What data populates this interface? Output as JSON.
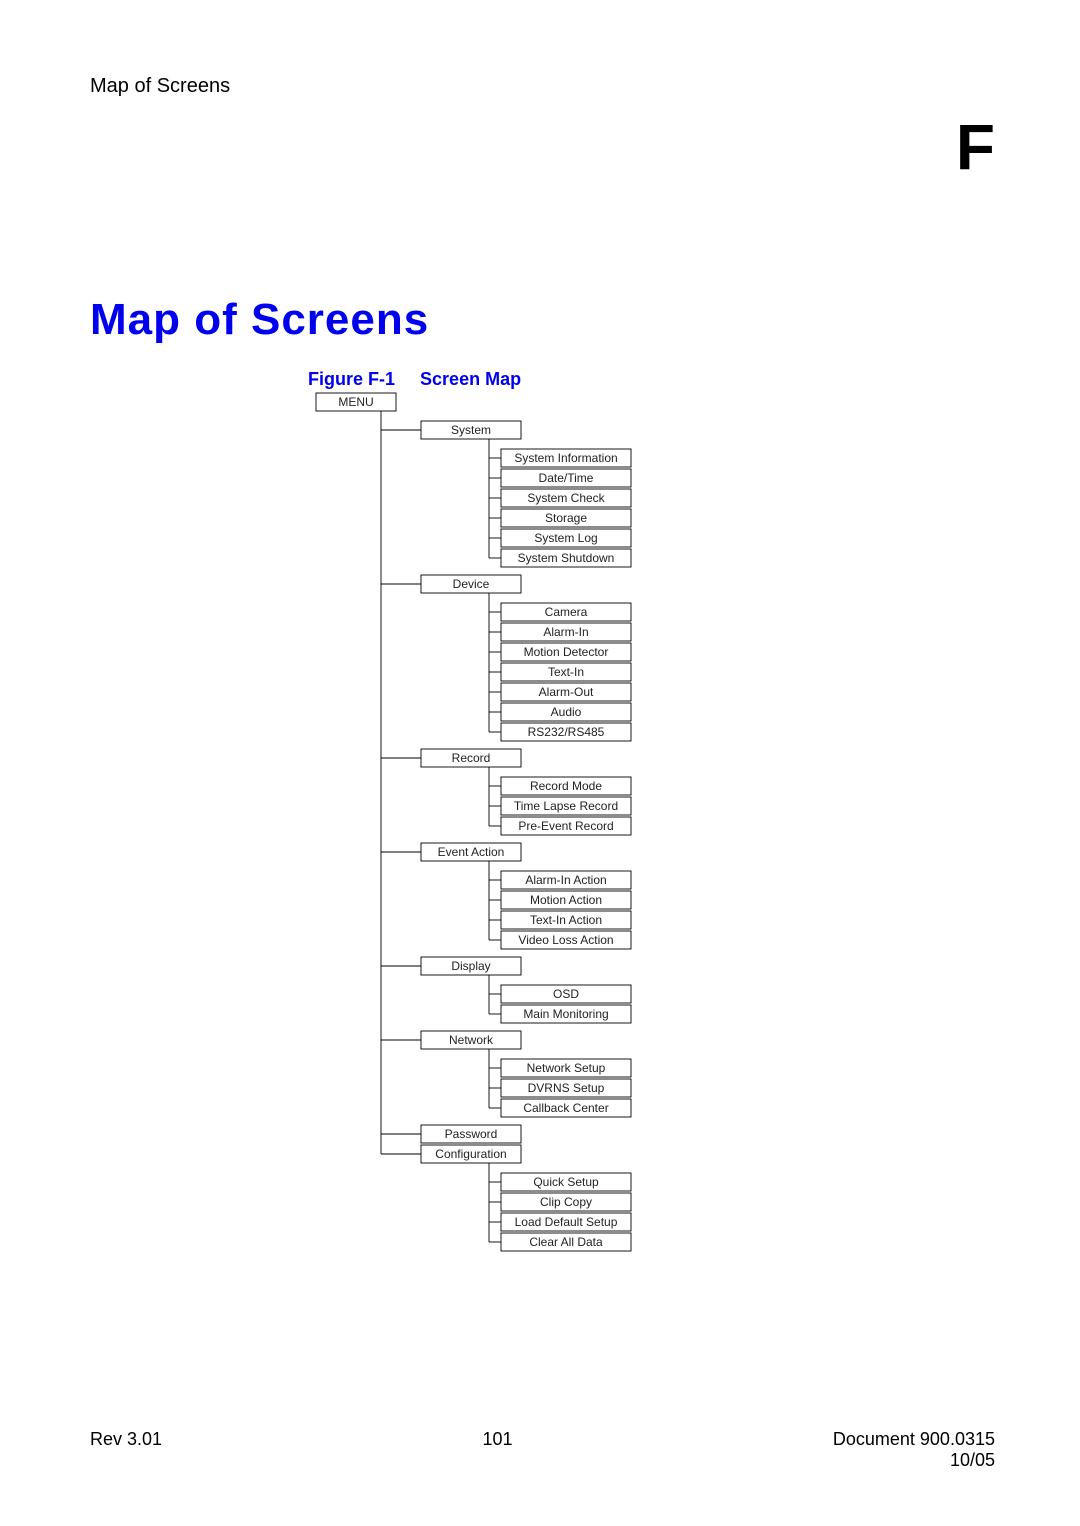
{
  "header": {
    "title": "Map of Screens"
  },
  "appendix_letter": "F",
  "main_title": "Map of Screens",
  "figure": {
    "label": "Figure F-1",
    "title": "Screen Map"
  },
  "tree": {
    "root": "MENU",
    "groups": [
      {
        "title": "System",
        "items": [
          "System Information",
          "Date/Time",
          "System Check",
          "Storage",
          "System Log",
          "System Shutdown"
        ]
      },
      {
        "title": "Device",
        "items": [
          "Camera",
          "Alarm-In",
          "Motion Detector",
          "Text-In",
          "Alarm-Out",
          "Audio",
          "RS232/RS485"
        ]
      },
      {
        "title": "Record",
        "items": [
          "Record Mode",
          "Time Lapse Record",
          "Pre-Event Record"
        ]
      },
      {
        "title": "Event Action",
        "items": [
          "Alarm-In Action",
          "Motion Action",
          "Text-In Action",
          "Video Loss Action"
        ]
      },
      {
        "title": "Display",
        "items": [
          "OSD",
          "Main Monitoring"
        ]
      },
      {
        "title": "Network",
        "items": [
          "Network Setup",
          "DVRNS Setup",
          "Callback Center"
        ]
      },
      {
        "title": "Password",
        "items": []
      },
      {
        "title": "Configuration",
        "items": [
          "Quick Setup",
          "Clip Copy",
          "Load Default Setup",
          "Clear All Data"
        ]
      }
    ]
  },
  "footer": {
    "rev": "Rev 3.01",
    "page": "101",
    "doc": "Document 900.0315",
    "date": "10/05"
  }
}
